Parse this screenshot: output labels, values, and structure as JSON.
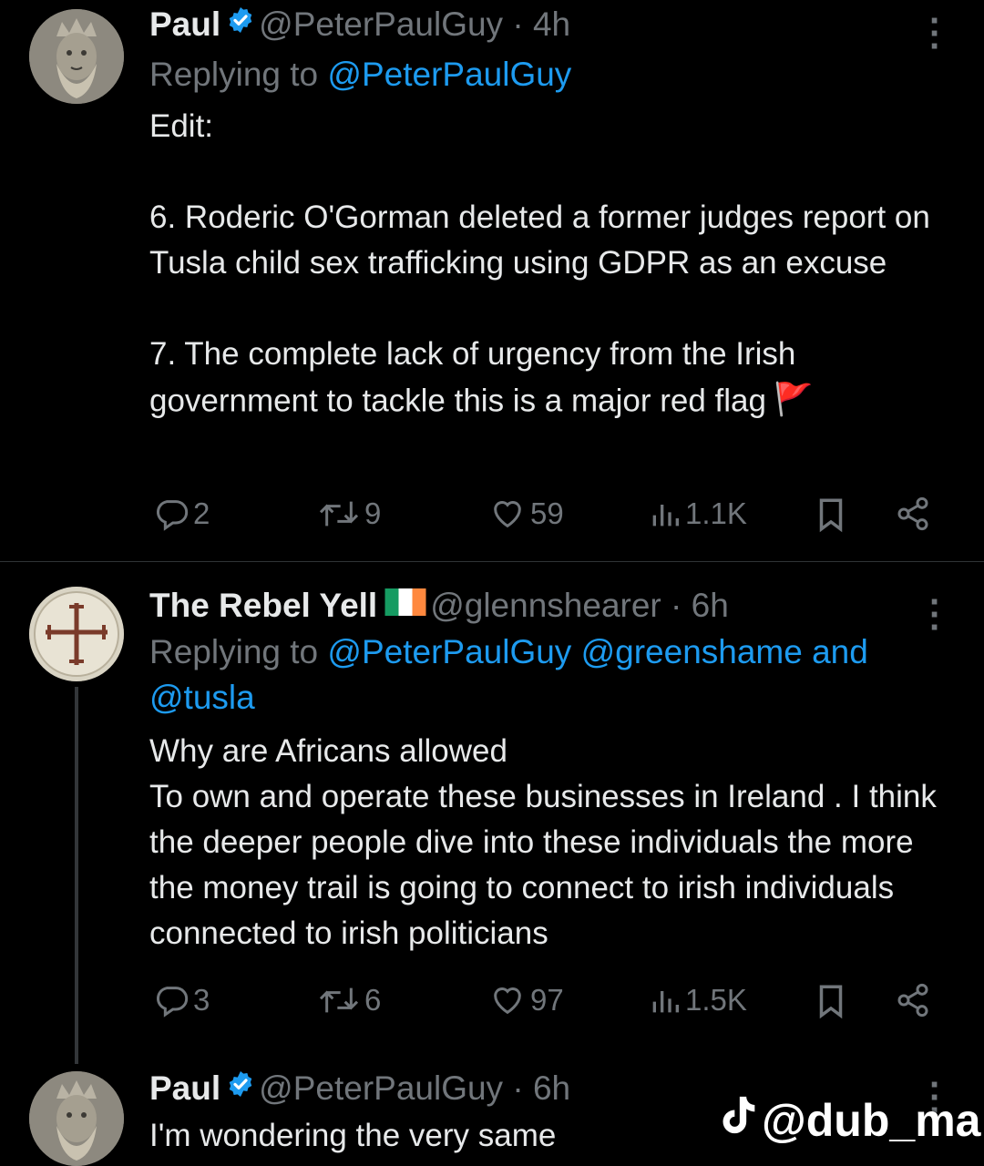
{
  "tweets": [
    {
      "name": "Paul",
      "handle": "@PeterPaulGuy",
      "time": "· 4h",
      "replying_prefix": "Replying to ",
      "replying_to": "@PeterPaulGuy",
      "body": "Edit:\n\n6. Roderic O'Gorman deleted a former judges report on Tusla child sex trafficking using GDPR as an excuse\n\n7. The complete lack of urgency from the Irish government to tackle this is a major red flag",
      "body_emoji": "🚩",
      "replies": "2",
      "retweets": "9",
      "likes": "59",
      "views": "1.1K"
    },
    {
      "name": "The Rebel Yell",
      "handle": "@glennshearer",
      "time": "· 6h",
      "replying_prefix": "Replying to ",
      "replying_to": "@PeterPaulGuy @greenshame and",
      "replying_to_2": "@tusla",
      "body": "Why are Africans allowed\nTo own and operate these businesses in Ireland . I think the deeper people dive into these individuals the more the money trail is going to connect to irish individuals connected to irish politicians",
      "replies": "3",
      "retweets": "6",
      "likes": "97",
      "views": "1.5K"
    },
    {
      "name": "Paul",
      "handle": "@PeterPaulGuy",
      "time": "· 6h",
      "body": "I'm wondering the very same"
    }
  ],
  "watermark": "@dub_ma",
  "colors": {
    "accent": "#1d9bf0",
    "muted": "#71767b",
    "text": "#e7e9ea",
    "background": "#000000"
  }
}
